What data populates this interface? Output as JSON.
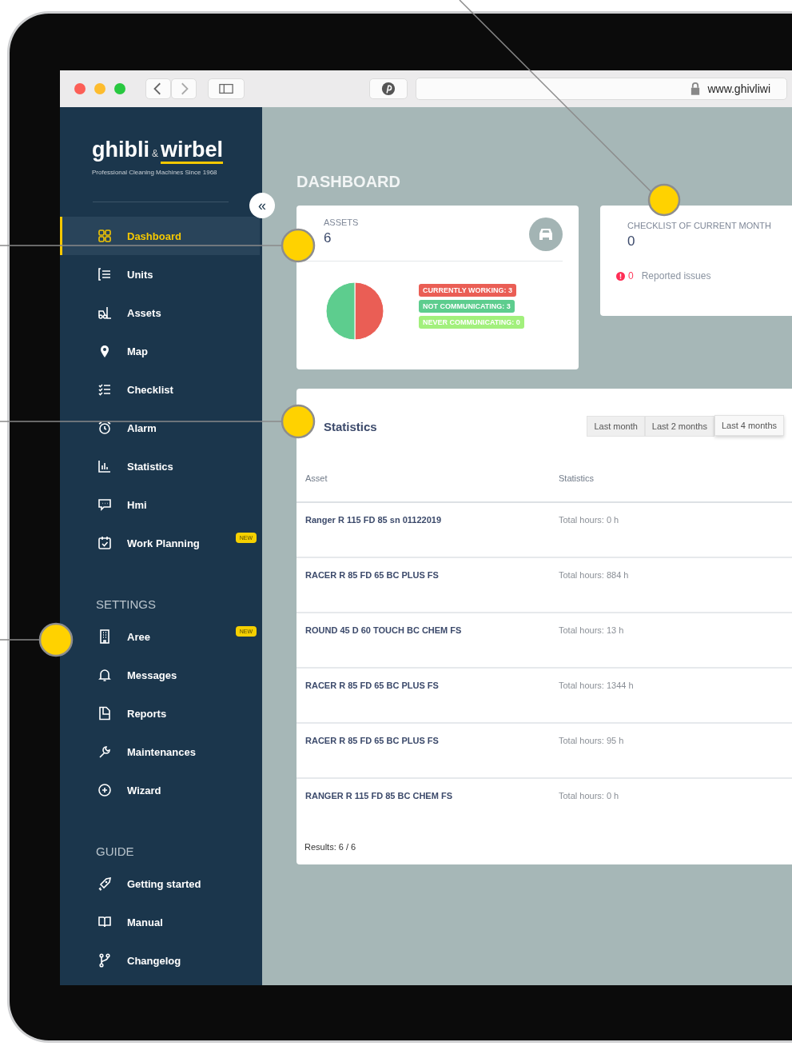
{
  "browser": {
    "url": "www.ghivliwi"
  },
  "sidebar": {
    "logo": {
      "word1": "ghibli",
      "ampersand": "&",
      "word2": "wirbel",
      "tagline": "Professional Cleaning Machines Since 1968"
    },
    "collapse_button": "«",
    "sections": [
      {
        "items": [
          {
            "label": "Dashboard",
            "selected": true
          },
          {
            "label": "Units",
            "selected": false
          },
          {
            "label": "Assets",
            "selected": false
          },
          {
            "label": "Map",
            "selected": false
          },
          {
            "label": "Checklist",
            "selected": false
          },
          {
            "label": "Alarm",
            "selected": false
          },
          {
            "label": "Statistics",
            "selected": false
          },
          {
            "label": "Hmi",
            "selected": false
          },
          {
            "label": "Work Planning",
            "selected": false,
            "badge": "NEW"
          }
        ]
      },
      {
        "heading": "SETTINGS",
        "items": [
          {
            "label": "Aree",
            "selected": false,
            "badge": "NEW"
          },
          {
            "label": "Messages",
            "selected": false
          },
          {
            "label": "Reports",
            "selected": false
          },
          {
            "label": "Maintenances",
            "selected": false
          },
          {
            "label": "Wizard",
            "selected": false
          }
        ]
      },
      {
        "heading": "GUIDE",
        "items": [
          {
            "label": "Getting started",
            "selected": false
          },
          {
            "label": "Manual",
            "selected": false
          },
          {
            "label": "Changelog",
            "selected": false
          }
        ]
      }
    ]
  },
  "page": {
    "title": "DASHBOARD"
  },
  "assets_card": {
    "label": "ASSETS",
    "value": "6",
    "chart_data": {
      "type": "pie",
      "values": [
        50,
        50,
        0
      ]
    },
    "legend": [
      {
        "label": "CURRENTLY WORKING: 3",
        "color": "#ea5e55"
      },
      {
        "label": "NOT COMMUNICATING: 3",
        "color": "#5dcd8e"
      },
      {
        "label": "NEVER COMMUNICATING: 0",
        "color": "#a2f07c"
      }
    ]
  },
  "checklist_card": {
    "label": "CHECKLIST OF CURRENT MONTH",
    "value": "0",
    "issues_count": "0",
    "issues_label": "Reported issues"
  },
  "statistics": {
    "title": "Statistics",
    "ranges": [
      {
        "label": "Last month",
        "selected": false
      },
      {
        "label": "Last 2 months",
        "selected": false
      },
      {
        "label": "Last 4 months",
        "selected": true
      }
    ],
    "columns": [
      "Asset",
      "Statistics"
    ],
    "rows": [
      [
        "Ranger R 115 FD 85 sn 01122019",
        "Total hours: 0 h"
      ],
      [
        "RACER R 85 FD 65 BC PLUS FS",
        "Total hours: 884 h"
      ],
      [
        "ROUND 45 D 60 TOUCH BC CHEM FS",
        "Total hours: 13 h"
      ],
      [
        "RACER R 85 FD 65 BC PLUS FS",
        "Total hours: 1344 h"
      ],
      [
        "RACER R 85 FD 65 BC PLUS FS",
        "Total hours: 95 h"
      ],
      [
        "RANGER R 115 FD 85 BC CHEM FS",
        "Total hours: 0 h"
      ]
    ],
    "results": "Results: 6 / 6"
  }
}
